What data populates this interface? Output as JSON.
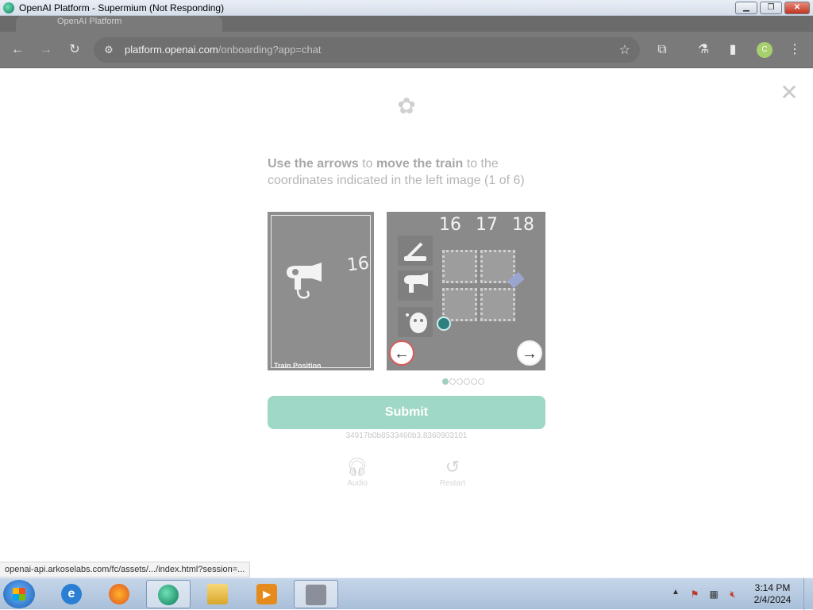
{
  "window": {
    "title": "OpenAI Platform - Supermium (Not Responding)",
    "buttons": {
      "minimize": "▁",
      "restore": "❐",
      "close": "✕"
    }
  },
  "tab": {
    "title": "OpenAI Platform"
  },
  "toolbar": {
    "back": "←",
    "forward": "→",
    "reload": "↻",
    "url_host": "platform.openai.com",
    "url_path": "/onboarding?app=chat",
    "star": "☆",
    "extensions": "⧉",
    "labs": "⚗",
    "sidepanel": "▮",
    "avatar": "C",
    "menu": "⋮"
  },
  "challenge": {
    "prompt_bold_1": "Use the arrows",
    "prompt_text_1": " to ",
    "prompt_bold_2": "move the train",
    "prompt_text_2": " to the coordinates indicated in the left image (1 of 6)",
    "left_image": {
      "caption": "Train Position",
      "number": "16",
      "icon": "hair-dryer-icon"
    },
    "right_image": {
      "ticks": [
        "16",
        "17",
        "18"
      ],
      "row_icons": [
        "toothbrush-icon",
        "hair-dryer-icon",
        "face-mask-icon"
      ]
    },
    "arrow_left": "←",
    "arrow_right": "→",
    "progress": {
      "current": 1,
      "total": 6
    },
    "submit_label": "Submit",
    "session_id": "34917b0b8533460b3.8360903101",
    "audio_label": "Audio",
    "restart_label": "Restart"
  },
  "status_bar": {
    "url": "openai-api.arkoselabs.com/fc/assets/.../index.html?session=..."
  },
  "taskbar": {
    "apps": [
      "internet-explorer",
      "firefox",
      "supermium",
      "file-explorer",
      "media-player",
      "printer"
    ],
    "clock_time": "3:14 PM",
    "clock_date": "2/4/2024"
  }
}
